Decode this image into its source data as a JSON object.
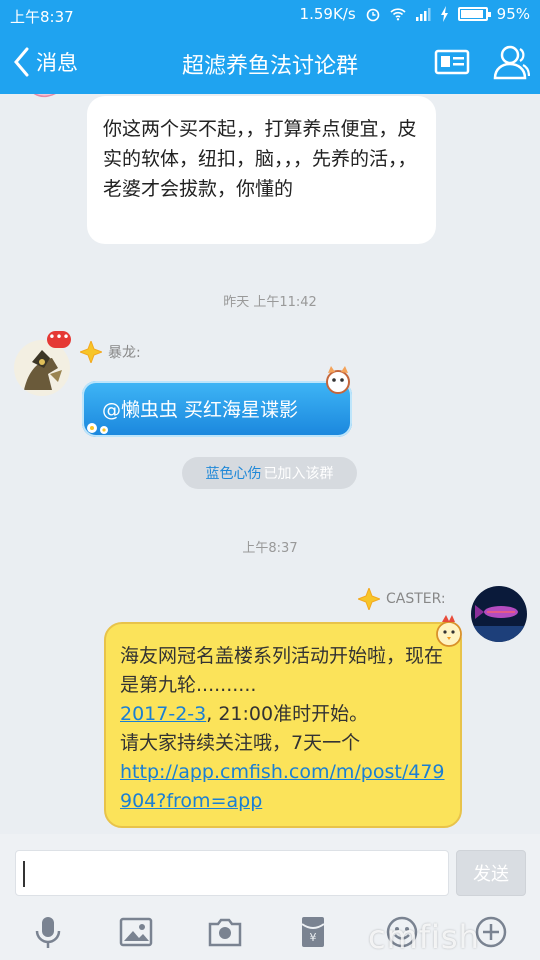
{
  "status_bar": {
    "time": "上午8:37",
    "network_speed": "1.59K/s",
    "battery": "95%",
    "battery_level": 0.95
  },
  "header": {
    "back_label": "消息",
    "title": "超滤养鱼法讨论群",
    "icons": [
      "chevron-left-icon",
      "profile-card-icon",
      "group-members-icon"
    ]
  },
  "messages": {
    "m1": {
      "text": "你这两个买不起，，打算养点便宜，皮实的软体，纽扣，脑，，，先养的活，，老婆才会拔款，你懂的"
    },
    "ts1": "昨天 上午11:42",
    "m2": {
      "sender": "暴龙:",
      "text": "@懒虫虫  买红海星谍影"
    },
    "join_notice": {
      "name": "蓝色心伤",
      "text": "已加入该群"
    },
    "ts2": "上午8:37",
    "m3": {
      "sender": "CASTER:",
      "line1": "海友网冠名盖楼系列活动开始啦，现在是第九轮..........",
      "date_link": "2017-2-3",
      "line2": ", 21:00准时开始。",
      "line3": "请大家持续关注哦，7天一个",
      "url": "http://app.cmfish.com/m/post/479904?from=app"
    }
  },
  "input": {
    "value": "",
    "send_label": "发送"
  },
  "toolbar_icons": [
    "microphone-icon",
    "image-icon",
    "camera-icon",
    "red-packet-icon",
    "emoji-icon",
    "plus-icon"
  ],
  "watermark": "cmfish",
  "colors": {
    "brand_blue": "#1fa3f0",
    "yellow_bubble": "#fbe35a",
    "link": "#1a7fd4"
  }
}
